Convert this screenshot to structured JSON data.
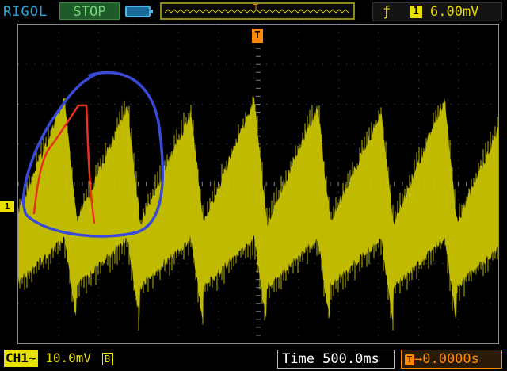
{
  "topbar": {
    "brand": "RIGOL",
    "run_status": "STOP",
    "trigger_edge_symbol": "ƒ",
    "trigger_channel": "1",
    "trigger_level": "6.00mV"
  },
  "screen": {
    "trigger_position_marker": "T",
    "channel_marker": "1"
  },
  "bottombar": {
    "channel_label": "CH1",
    "coupling_symbol": "~",
    "volts_per_div": "10.0mV",
    "bandwidth_limit": "B",
    "timebase": "Time 500.0ms",
    "trigger_offset_symbol": "T",
    "trigger_offset": "→0.0000s"
  },
  "colors": {
    "trace": "#c8c200",
    "annotation_blue": "#3a4ad8",
    "annotation_red": "#e83020",
    "trigger_orange": "#ff8a00"
  }
}
